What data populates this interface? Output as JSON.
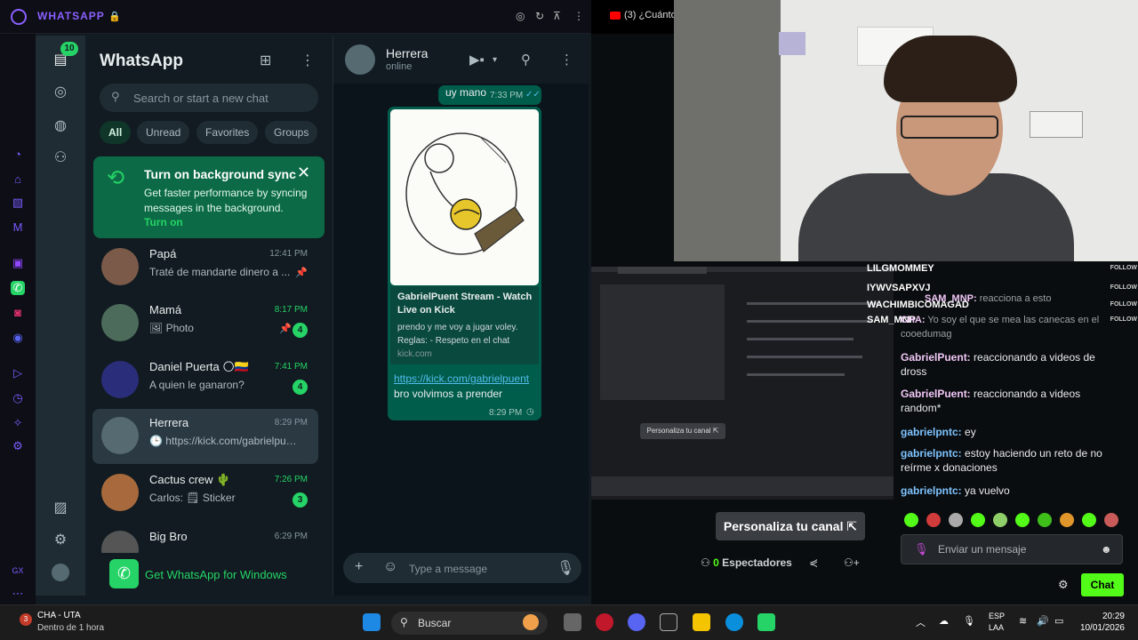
{
  "browser": {
    "app_title": "WHATSAPP",
    "other_tab": "(3) ¿Cuánto"
  },
  "whatsapp": {
    "rail_badge": "10",
    "title": "WhatsApp",
    "search_placeholder": "Search or start a new chat",
    "filters": [
      "All",
      "Unread",
      "Favorites",
      "Groups"
    ],
    "sync_banner": {
      "title": "Turn on background sync",
      "body": "Get faster performance by syncing messages in the background.",
      "link": "Turn on"
    },
    "chats": [
      {
        "name": "Papá",
        "time": "12:41 PM",
        "preview": "Traté de mandarte dinero a ...",
        "unread": "",
        "pinned": true,
        "avatar_color": "#7b5a4a"
      },
      {
        "name": "Mamá",
        "time": "8:17 PM",
        "preview": "🖼 Photo",
        "unread": "4",
        "pinned": true,
        "avatar_color": "#4d6b5a"
      },
      {
        "name": "Daniel Puerta 🌕🇨🇴",
        "time": "7:41 PM",
        "preview": "A quien le ganaron?",
        "unread": "4",
        "pinned": false,
        "avatar_color": "#2a2e7a"
      },
      {
        "name": "Herrera",
        "time": "8:29 PM",
        "preview": "🕒 https://kick.com/gabrielpue...",
        "unread": "",
        "pinned": false,
        "avatar_color": "#566a72"
      },
      {
        "name": "Cactus crew 🌵",
        "time": "7:26 PM",
        "preview": "Carlos: 🗒 Sticker",
        "unread": "3",
        "pinned": false,
        "avatar_color": "#a86a3c"
      },
      {
        "name": "Big Bro",
        "time": "6:29 PM",
        "preview": "",
        "unread": "",
        "pinned": false,
        "avatar_color": "#555"
      }
    ],
    "get_windows": "Get WhatsApp for Windows",
    "conversation": {
      "contact": "Herrera",
      "status": "online",
      "msg1": "uy mano",
      "msg1_time": "7:33 PM",
      "link_card_title": "GabrielPuent Stream - Watch Live on Kick",
      "link_card_desc": "prendo y me voy a jugar voley. Reglas: - Respeto en el chat",
      "link_card_domain": "kick.com",
      "link_url": "https://kick.com/gabrielpuent",
      "link_msg": "bro volvimos a prender",
      "link_time": "8:29 PM",
      "composer_placeholder": "Type a message"
    }
  },
  "stream": {
    "preview_button": "Personaliza tu canal ⇱",
    "customize_button": "Personaliza tu canal",
    "spectators_count": "0",
    "spectators_label": "Espectadores",
    "followers": [
      "LILGMOMMEY",
      "IYWVSAPXVJ",
      "WACHIMBICOMAGAD",
      "SAM_MNP"
    ],
    "follow_label": "FOLLOW",
    "chat": [
      {
        "user": "SAM_MNP:",
        "text": "reacciona a esto",
        "style": "u"
      },
      {
        "user": "CHA:",
        "text": "Yo soy el que se mea las canecas en el cooedumag",
        "style": "u"
      },
      {
        "user": "GabrielPuent:",
        "text": "reaccionando a videos de dross",
        "style": "u"
      },
      {
        "user": "GabrielPuent:",
        "text": "reaccionando a videos random*",
        "style": "u"
      },
      {
        "user": "gabrielpntc:",
        "text": "ey",
        "style": "u2"
      },
      {
        "user": "gabrielpntc:",
        "text": "estoy haciendo un reto de no reírme x donaciones",
        "style": "u2"
      },
      {
        "user": "gabrielpntc:",
        "text": "ya vuelvo",
        "style": "u2"
      }
    ],
    "chat_input_placeholder": "Enviar un mensaje",
    "chat_button": "Chat"
  },
  "taskbar": {
    "weather_title": "CHA - UTA",
    "weather_sub": "Dentro de 1 hora",
    "weather_badge": "3",
    "search": "Buscar",
    "lang1": "ESP",
    "lang2": "LAA",
    "time": "20:29",
    "date": "10/01/2026"
  }
}
